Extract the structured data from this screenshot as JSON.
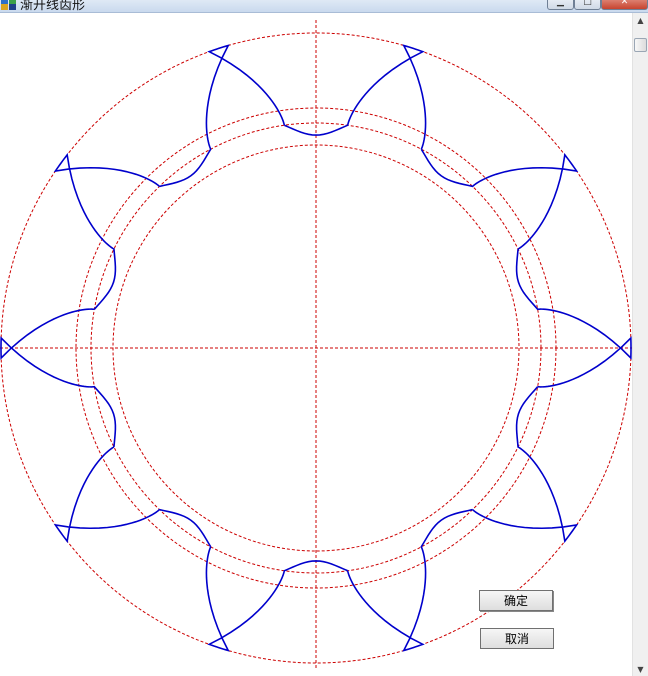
{
  "window": {
    "title": "渐开线齿形",
    "icon": "app-icon",
    "controls": [
      "minimize-icon",
      "maximize-icon",
      "close-icon"
    ]
  },
  "drawing": {
    "tooth_count": 10,
    "colors": {
      "profile": "#0000cc",
      "circles": "#cc0000",
      "axes": "#cc0000"
    }
  },
  "buttons": {
    "ok_label": "确定",
    "cancel_label": "取消"
  }
}
